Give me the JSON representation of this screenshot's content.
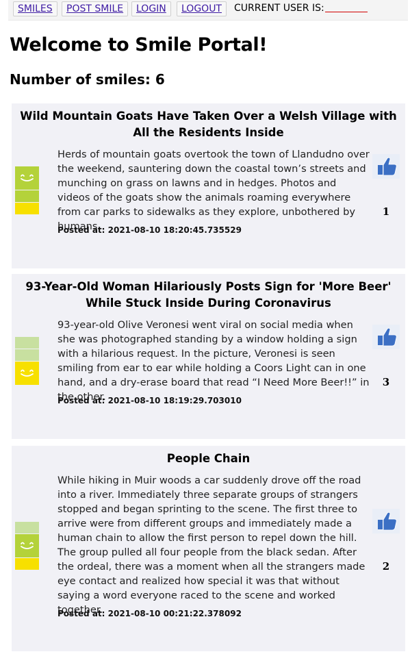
{
  "nav": {
    "smiles_label": "SMILES",
    "post_smile_label": "POST SMILE",
    "login_label": "LOGIN",
    "logout_label": "LOGOUT",
    "current_user_label": "CURRENT USER IS:",
    "current_user_value": ""
  },
  "page": {
    "title": "Welcome to Smile Portal!",
    "count_label": "Number of smiles: 6"
  },
  "colors": {
    "link": "#3d1aa3",
    "card_bg": "#f1f1f6",
    "meter_green": "#b4d23a",
    "meter_green_light": "#c8e0a0",
    "meter_yellow": "#f7e000",
    "like_blue": "#3b6fc4"
  },
  "posts": [
    {
      "title": "Wild Mountain Goats Have Taken Over a Welsh Village with All the Residents Inside",
      "text": "Herds of mountain goats overtook the town of Llandudno over the weekend, sauntering down the coastal town’s streets and munching on grass on lawns and in hedges. Photos and videos of the goats show the animals roaming everywhere from car parks to sidewalks as they explore, unbothered by humans.",
      "posted_at": "Posted at: 2021-08-10 18:20:45.735529",
      "likes": "1",
      "happiness_level": 3,
      "icon": "smile-meter-icon"
    },
    {
      "title": "93-Year-Old Woman Hilariously Posts Sign for 'More Beer' While Stuck Inside During Coronavirus",
      "text": "93-year-old Olive Veronesi went viral on social media when she was photographed standing by a window holding a sign with a hilarious request. In the picture, Veronesi is seen smiling from ear to ear while holding a Coors Light can in one hand, and a dry-erase board that read “I Need More Beer!!” in the other.",
      "posted_at": "Posted at: 2021-08-10 18:19:29.703010",
      "likes": "3",
      "happiness_level": 1,
      "icon": "smile-meter-icon"
    },
    {
      "title": "People Chain",
      "text": "While hiking in Muir woods a car suddenly drove off the road into a river. Immediately three separate groups of strangers stopped and began sprinting to the scene. The first three to arrive were from different groups and immediately made a human chain to allow the first person to repel down the hill. The group pulled all four people from the black sedan. After the ordeal, there was a moment when all the strangers made eye contact and realized how special it was that without saying a word everyone raced to the scene and worked together.",
      "posted_at": "Posted at: 2021-08-10 00:21:22.378092",
      "likes": "2",
      "happiness_level": 2,
      "icon": "smile-meter-icon"
    }
  ],
  "like_icon": "thumbs-up-icon"
}
